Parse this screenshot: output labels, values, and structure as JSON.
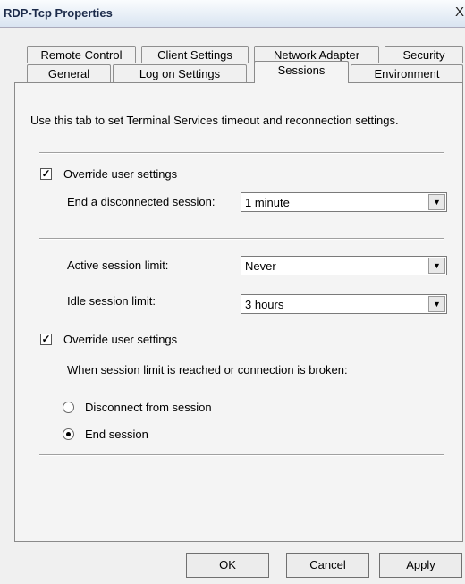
{
  "window": {
    "title": "RDP-Tcp Properties",
    "close_glyph": "X"
  },
  "tabs": {
    "row1": [
      "Remote Control",
      "Client Settings",
      "Network Adapter",
      "Security"
    ],
    "row2": [
      "General",
      "Log on Settings",
      "Sessions",
      "Environment"
    ],
    "active": "Sessions"
  },
  "sessions": {
    "intro": "Use this tab to set Terminal Services timeout and reconnection settings.",
    "override1": {
      "label": "Override user settings",
      "checked": true
    },
    "end_disconnected": {
      "label": "End a disconnected session:",
      "value": "1 minute"
    },
    "active_limit": {
      "label": "Active session limit:",
      "value": "Never"
    },
    "idle_limit": {
      "label": "Idle session limit:",
      "value": "3 hours"
    },
    "override2": {
      "label": "Override user settings",
      "checked": true
    },
    "limit_reached": "When session limit is reached or connection is broken:",
    "radio_disconnect": {
      "label": "Disconnect from session",
      "selected": false
    },
    "radio_end": {
      "label": "End session",
      "selected": true
    }
  },
  "buttons": {
    "ok": "OK",
    "cancel": "Cancel",
    "apply": "Apply"
  }
}
